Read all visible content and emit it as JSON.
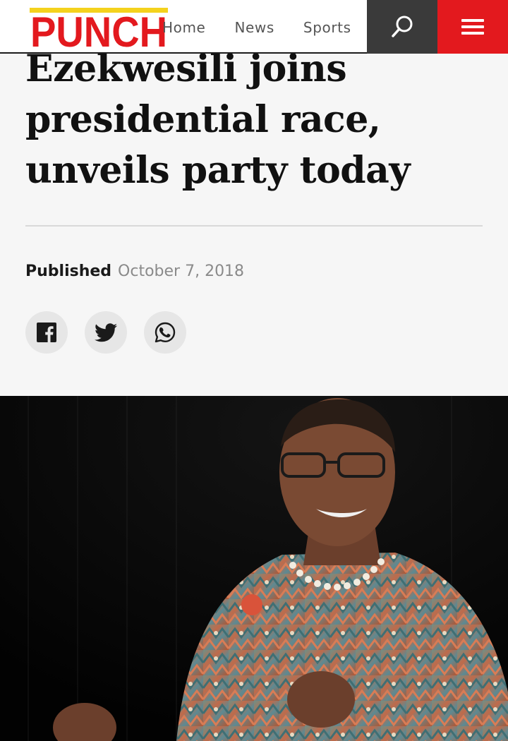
{
  "header": {
    "logo_text": "PUNCH",
    "nav": [
      {
        "label": "Home"
      },
      {
        "label": "News"
      },
      {
        "label": "Sports"
      }
    ],
    "search_icon": "search-icon",
    "menu_icon": "hamburger-menu-icon",
    "colors": {
      "brand_red": "#e3191e",
      "brand_yellow": "#f4d21d",
      "search_bg": "#3a3a3a"
    }
  },
  "article": {
    "headline": "Ezekwesili joins presidential race, unveils party today",
    "published_label": "Published",
    "published_date": "October 7, 2018",
    "share_buttons": [
      {
        "icon": "facebook-icon"
      },
      {
        "icon": "twitter-icon"
      },
      {
        "icon": "whatsapp-icon"
      }
    ],
    "hero_image": "photo of a woman in a colorful patterned dress speaking on stage against a dark background"
  }
}
